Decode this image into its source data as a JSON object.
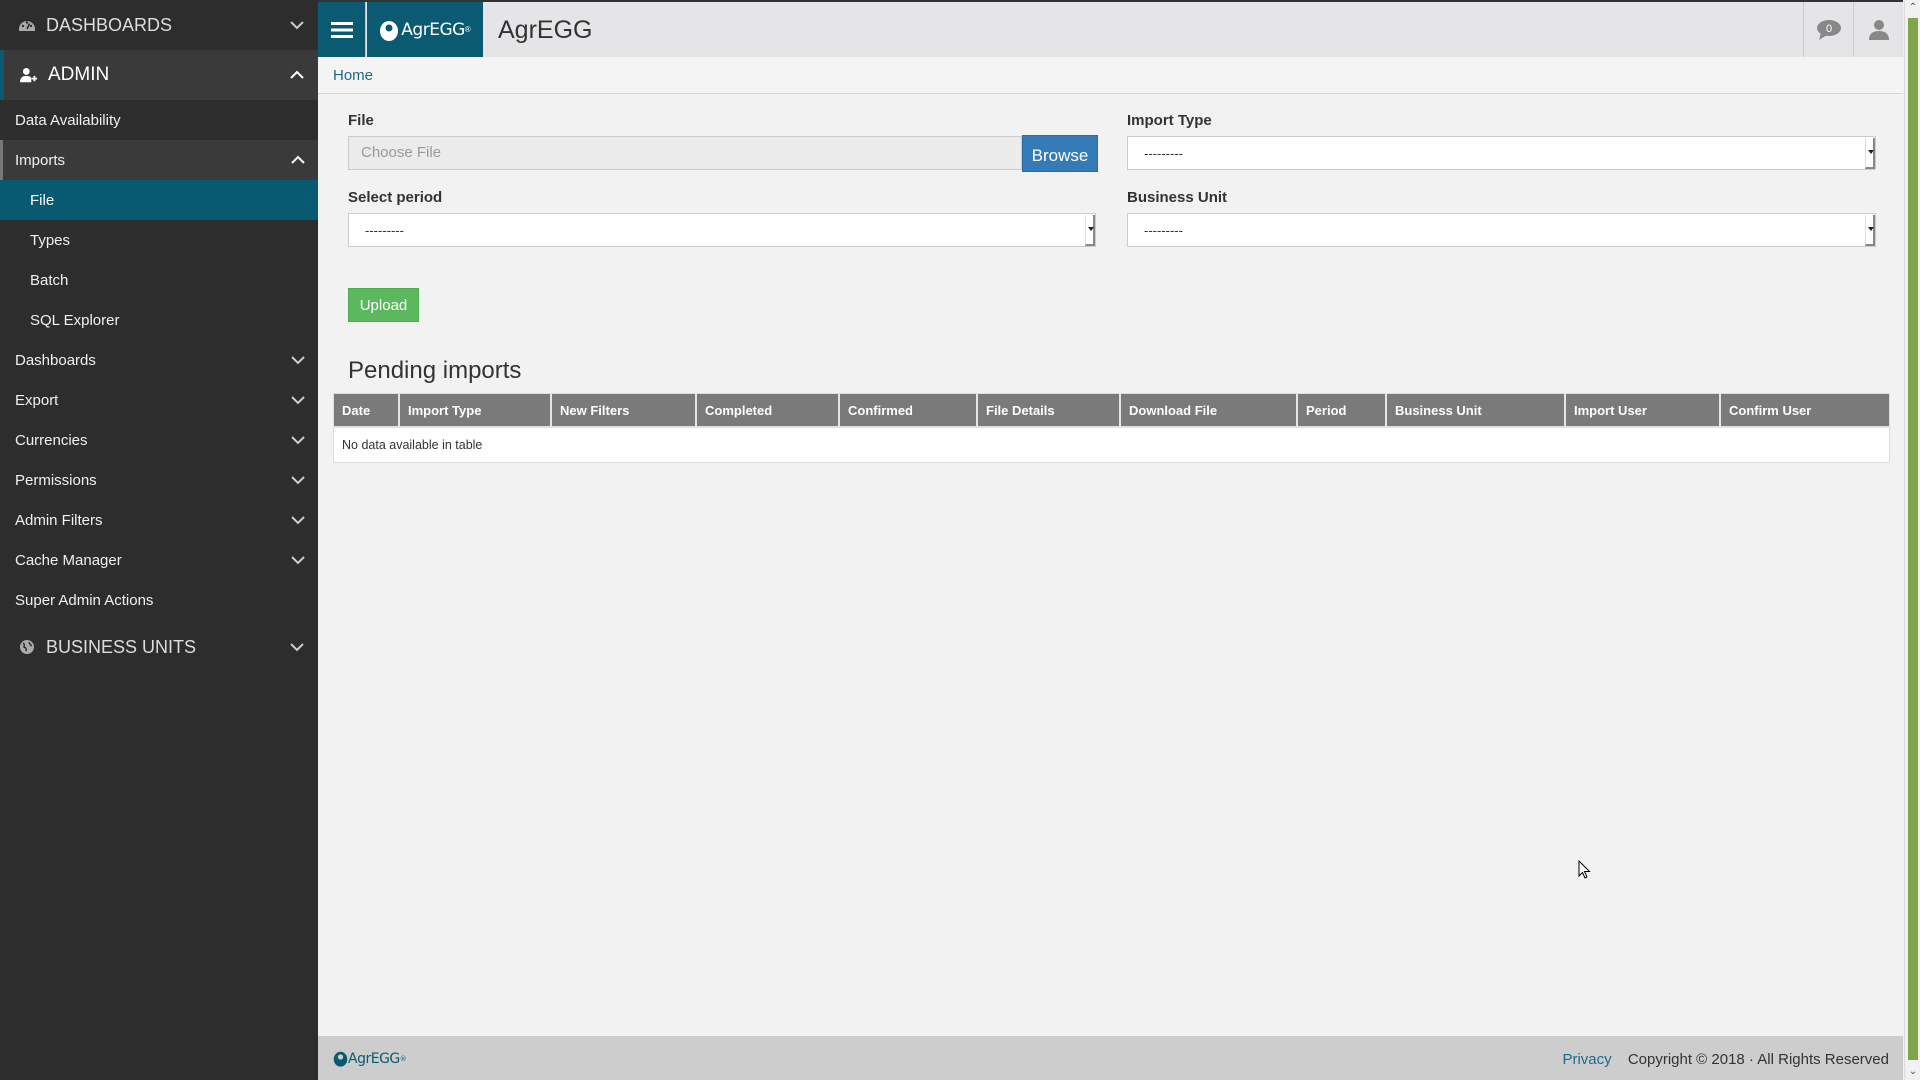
{
  "sidebar": {
    "dashboards_section": "DASHBOARDS",
    "admin_section": "ADMIN",
    "items": [
      {
        "label": "Data Availability"
      },
      {
        "label": "Imports"
      },
      {
        "label": "File"
      },
      {
        "label": "Types"
      },
      {
        "label": "Batch"
      },
      {
        "label": "SQL Explorer"
      },
      {
        "label": "Dashboards"
      },
      {
        "label": "Export"
      },
      {
        "label": "Currencies"
      },
      {
        "label": "Permissions"
      },
      {
        "label": "Admin Filters"
      },
      {
        "label": "Cache Manager"
      },
      {
        "label": "Super Admin Actions"
      }
    ],
    "business_units_section": "BUSINESS UNITS"
  },
  "header": {
    "logo_text": "AgrEGG",
    "logo_reg": "®",
    "title": "AgrEGG",
    "messages_count": "0"
  },
  "breadcrumb": {
    "home": "Home"
  },
  "form": {
    "file_label": "File",
    "file_placeholder": "Choose File",
    "browse_label": "Browse",
    "import_type_label": "Import Type",
    "import_type_value": "---------",
    "period_label": "Select period",
    "period_value": "---------",
    "business_unit_label": "Business Unit",
    "business_unit_value": "---------",
    "upload_label": "Upload"
  },
  "pending": {
    "title": "Pending imports",
    "columns": [
      "Date",
      "Import Type",
      "New Filters",
      "Completed",
      "Confirmed",
      "File Details",
      "Download File",
      "Period",
      "Business Unit",
      "Import User",
      "Confirm User"
    ],
    "empty_message": "No data available in table"
  },
  "footer": {
    "logo_text": "AgrEGG",
    "logo_reg": "®",
    "privacy": "Privacy",
    "copyright": "Copyright © 2018 · All Rights Reserved"
  },
  "colors": {
    "brand": "#0a5a72",
    "sidebar_bg": "#2d2d2d",
    "browse": "#337ab7",
    "upload": "#5cb85c",
    "table_header": "#7a7a7a",
    "scrollbar_thumb": "#7fa64a"
  }
}
